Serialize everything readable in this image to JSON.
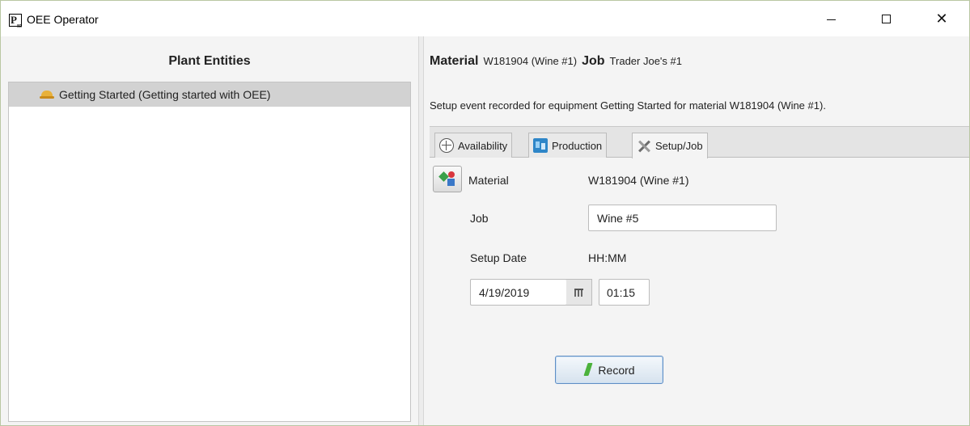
{
  "window": {
    "title": "OEE Operator",
    "icon_letter": "P",
    "icon_sub": "85",
    "minimize_label": "—",
    "maximize_label": "",
    "close_label": "✕"
  },
  "left": {
    "heading": "Plant Entities",
    "tree_items": [
      {
        "label": "Getting Started (Getting started with OEE)",
        "icon": "equipment-icon"
      }
    ]
  },
  "right": {
    "material_label": "Material",
    "material_value": "W181904 (Wine #1)",
    "job_label": "Job",
    "job_value": "Trader Joe's #1",
    "status_message": "Setup event recorded for equipment Getting Started for material W181904 (Wine #1).",
    "tabs": [
      {
        "label": "Availability",
        "icon": "clock-icon"
      },
      {
        "label": "Production",
        "icon": "production-icon"
      },
      {
        "label": "Setup/Job",
        "icon": "tools-icon",
        "active": true
      }
    ],
    "form": {
      "material_label": "Material",
      "material_value": "W181904 (Wine #1)",
      "job_label": "Job",
      "job_value": "Wine #5",
      "setup_date_label": "Setup Date",
      "time_format_label": "HH:MM",
      "date_value": "4/19/2019",
      "time_value": "01:15",
      "record_label": "Record"
    }
  }
}
